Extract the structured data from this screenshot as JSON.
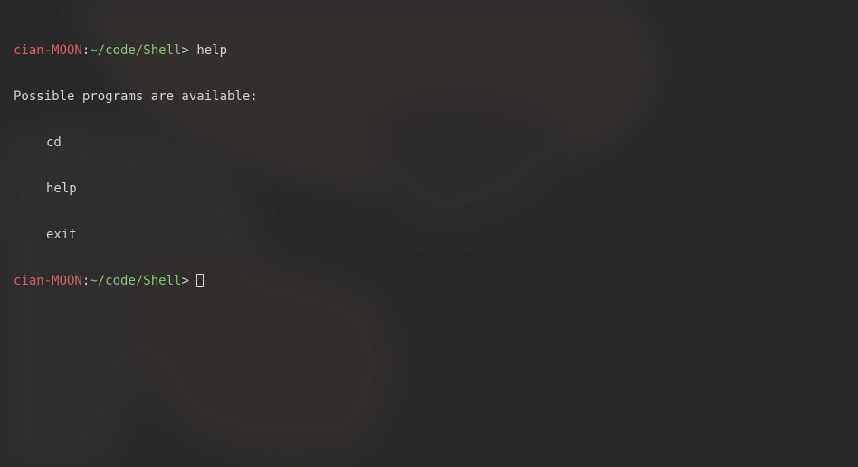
{
  "prompt": {
    "user": "cian-MOON",
    "separator": ":",
    "path": "~/code/Shell",
    "symbol": "> "
  },
  "history": [
    {
      "command": "help",
      "output_header": "Possible programs are available:",
      "output_items": [
        "cd",
        "help",
        "exit"
      ]
    }
  ],
  "current_input": "",
  "colors": {
    "background": "#2a2a2a",
    "user": "#d0626a",
    "path": "#8fbf7f",
    "text": "#d3d3d3"
  }
}
